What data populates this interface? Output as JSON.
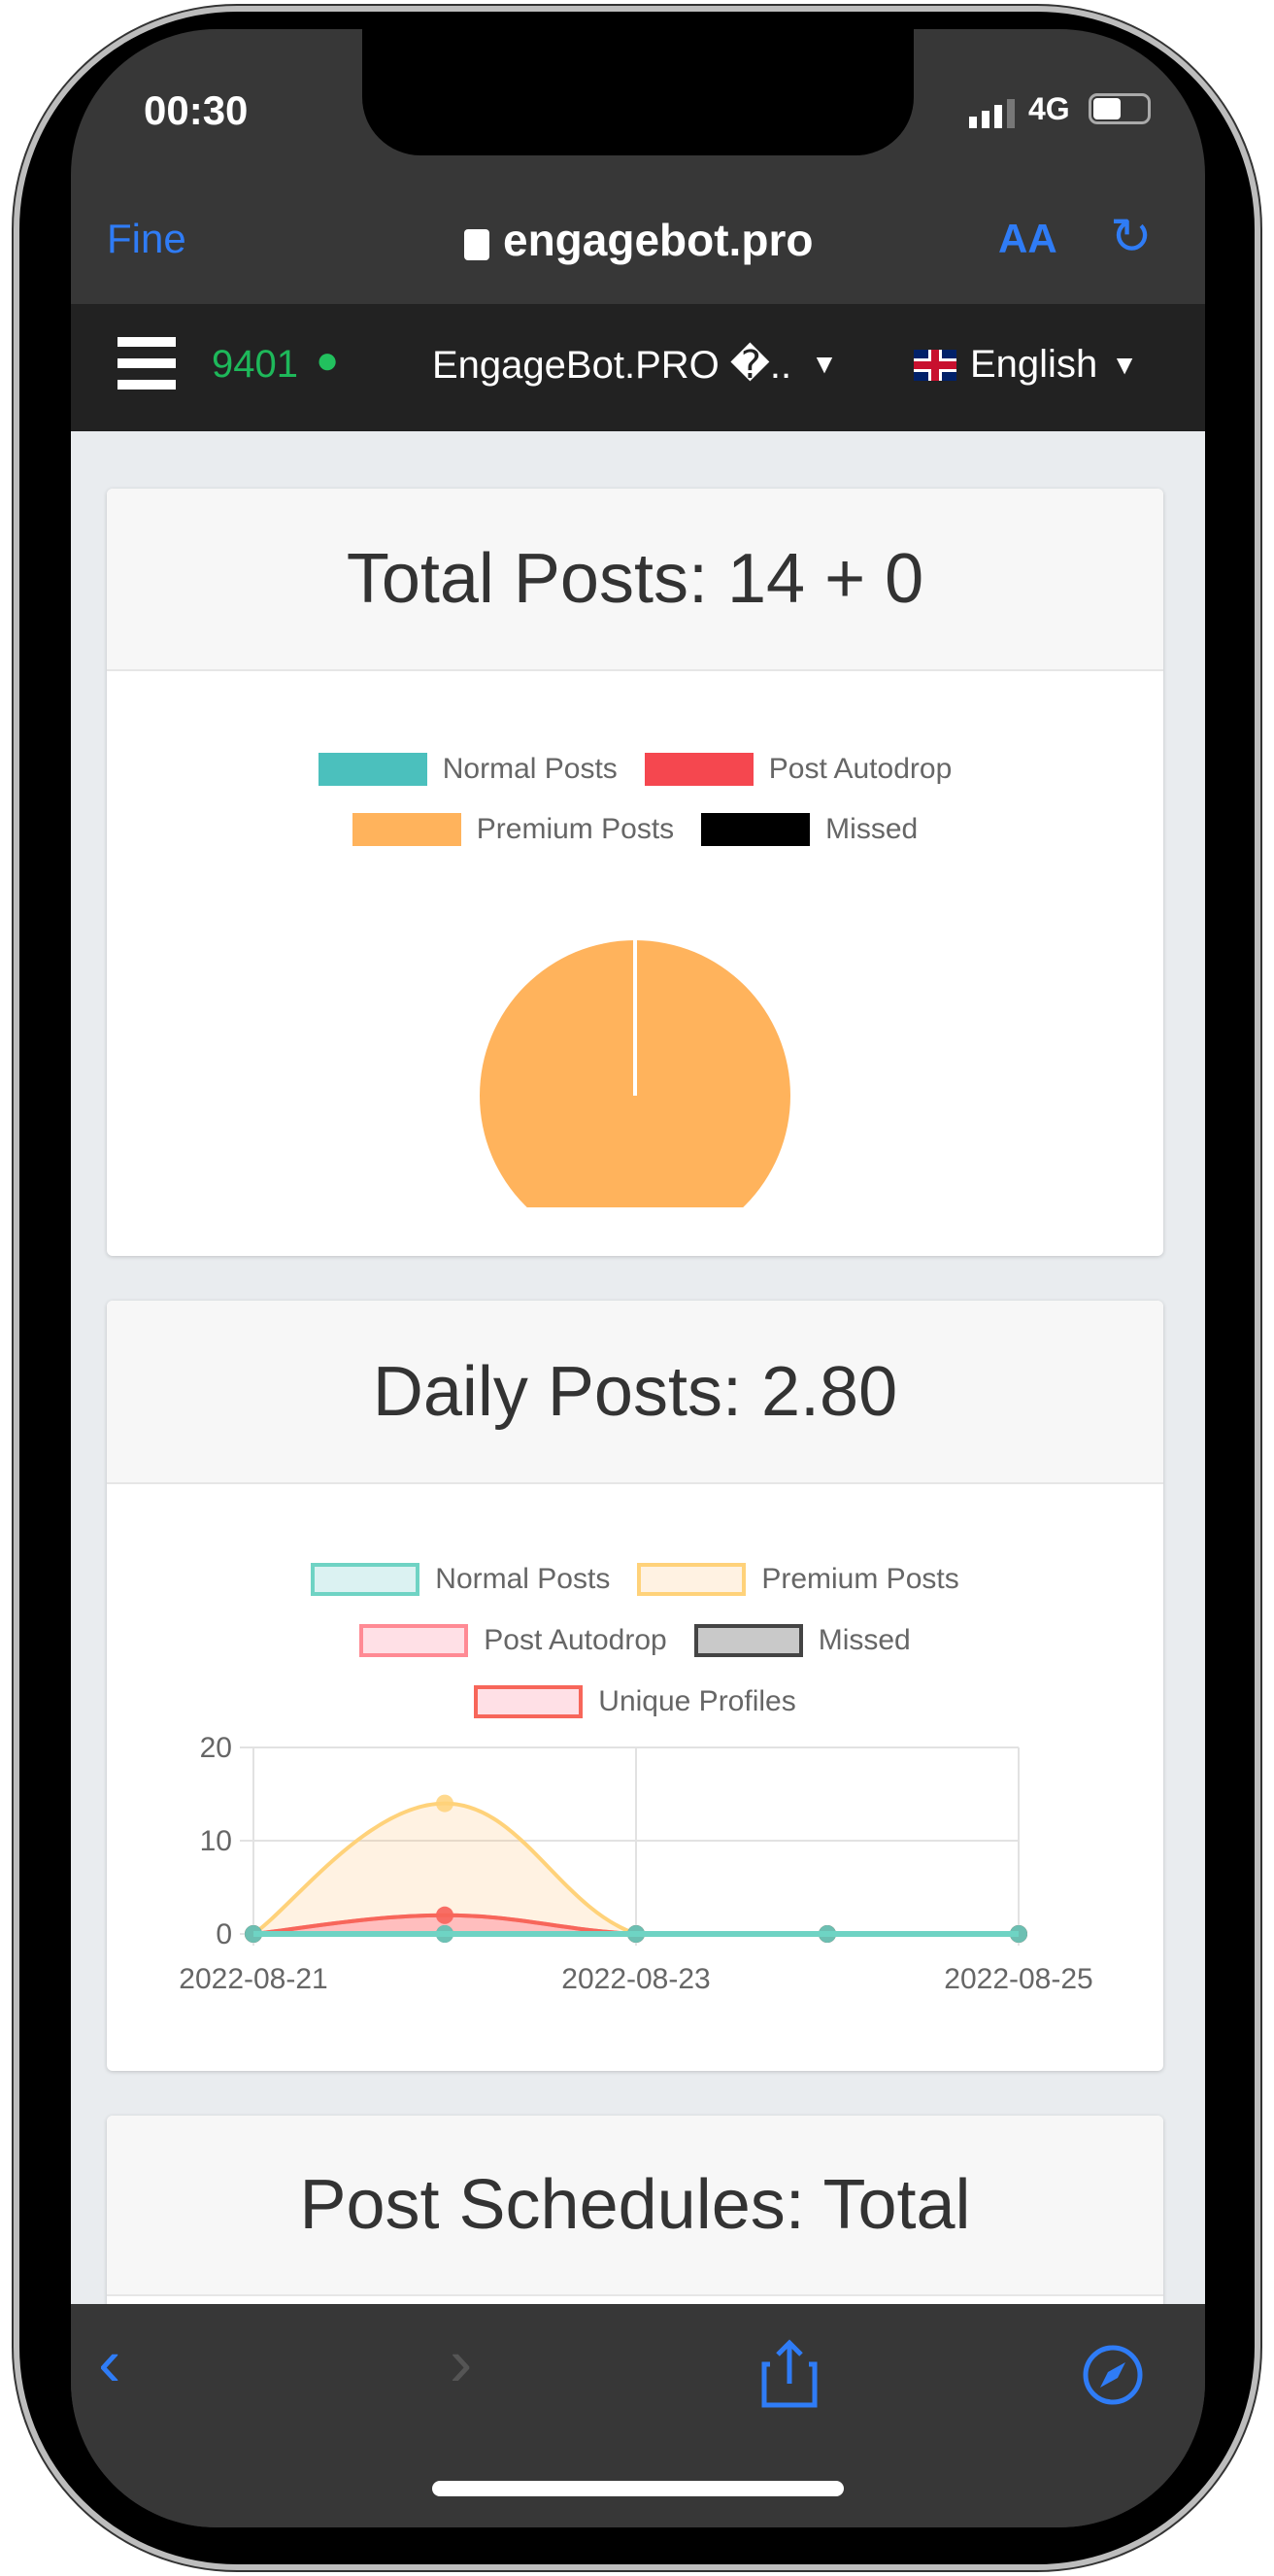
{
  "status_bar": {
    "time": "00:30",
    "network": "4G"
  },
  "safari": {
    "left_button": "Fine",
    "url": "engagebot.pro",
    "text_size": "AA"
  },
  "navbar": {
    "credits": "9401",
    "brand": "EngageBot.PRO �..",
    "language": "English"
  },
  "cards": [
    {
      "title": "Total Posts: 14 + 0"
    },
    {
      "title": "Daily Posts: 2.80"
    },
    {
      "title": "Post Schedules: Total"
    }
  ],
  "chart_data": [
    {
      "type": "pie",
      "legend": [
        "Normal Posts",
        "Post Autodrop",
        "Premium Posts",
        "Missed"
      ],
      "colors": [
        "#4bc0bd",
        "#f5474f",
        "#ffb35c",
        "#000000"
      ],
      "values": [
        0,
        0,
        14,
        0
      ],
      "legend_position": "top"
    },
    {
      "type": "area",
      "x": [
        "2022-08-21",
        "2022-08-22",
        "2022-08-23",
        "2022-08-24",
        "2022-08-25"
      ],
      "xticks": [
        "2022-08-21",
        "2022-08-23",
        "2022-08-25"
      ],
      "yticks": [
        "0",
        "10",
        "20"
      ],
      "ylim": [
        0,
        20
      ],
      "grid": true,
      "legend_position": "top",
      "series": [
        {
          "name": "Normal Posts",
          "values": [
            0,
            0,
            0,
            0,
            0
          ],
          "border": "#6fd3c4",
          "fill": "rgba(75,192,192,0.2)"
        },
        {
          "name": "Premium Posts",
          "values": [
            0,
            14,
            0,
            0,
            0
          ],
          "border": "#ffd27a",
          "fill": "rgba(255,190,110,0.2)"
        },
        {
          "name": "Post Autodrop",
          "values": [
            0,
            2,
            0,
            0,
            0
          ],
          "border": "#ff8a94",
          "fill": "rgba(255,99,132,0.2)"
        },
        {
          "name": "Missed",
          "values": [
            0,
            0,
            0,
            0,
            0
          ],
          "border": "#444444",
          "fill": "rgba(120,120,120,0.4)"
        },
        {
          "name": "Unique Profiles",
          "values": [
            0,
            2,
            0,
            0,
            0
          ],
          "border": "#f7665a",
          "fill": "rgba(255,99,132,0.2)"
        }
      ]
    }
  ]
}
